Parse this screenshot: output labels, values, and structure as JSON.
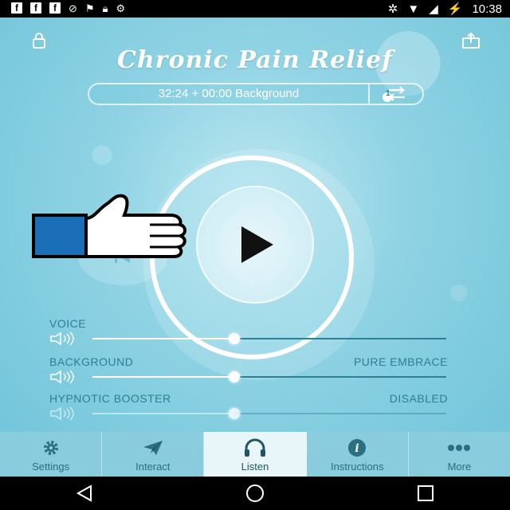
{
  "status_bar": {
    "time": "10:38",
    "left_icons": [
      "facebook-icon",
      "facebook-icon",
      "facebook-icon",
      "block-icon",
      "notification-icon",
      "lock-icon",
      "android-icon"
    ],
    "right_icons": [
      "bluetooth-icon",
      "wifi-icon",
      "no-signal-icon",
      "battery-charging-icon"
    ]
  },
  "header": {
    "title": "Chronic Pain Relief",
    "lock_icon": "lock-icon",
    "share_icon": "share-icon"
  },
  "timebar": {
    "text": "32:24 + 00:00 Background",
    "repeat_count": "1"
  },
  "player": {
    "play_icon": "play-icon",
    "rewind_icon": "skip-back-icon"
  },
  "sliders": [
    {
      "label": "VOICE",
      "value": "",
      "level": 0.4
    },
    {
      "label": "BACKGROUND",
      "value": "PURE EMBRACE",
      "level": 0.4
    },
    {
      "label": "HYPNOTIC BOOSTER",
      "value": "DISABLED",
      "level": 0.4
    }
  ],
  "tabs": [
    {
      "label": "Settings",
      "icon": "gear-icon"
    },
    {
      "label": "Interact",
      "icon": "send-icon"
    },
    {
      "label": "Listen",
      "icon": "headphones-icon",
      "active": true
    },
    {
      "label": "Instructions",
      "icon": "info-icon"
    },
    {
      "label": "More",
      "icon": "more-icon"
    }
  ],
  "nav": [
    "back-icon",
    "home-icon",
    "recents-icon"
  ],
  "colors": {
    "accent_text": "#2f7e93",
    "background": "#8fd3e4"
  }
}
